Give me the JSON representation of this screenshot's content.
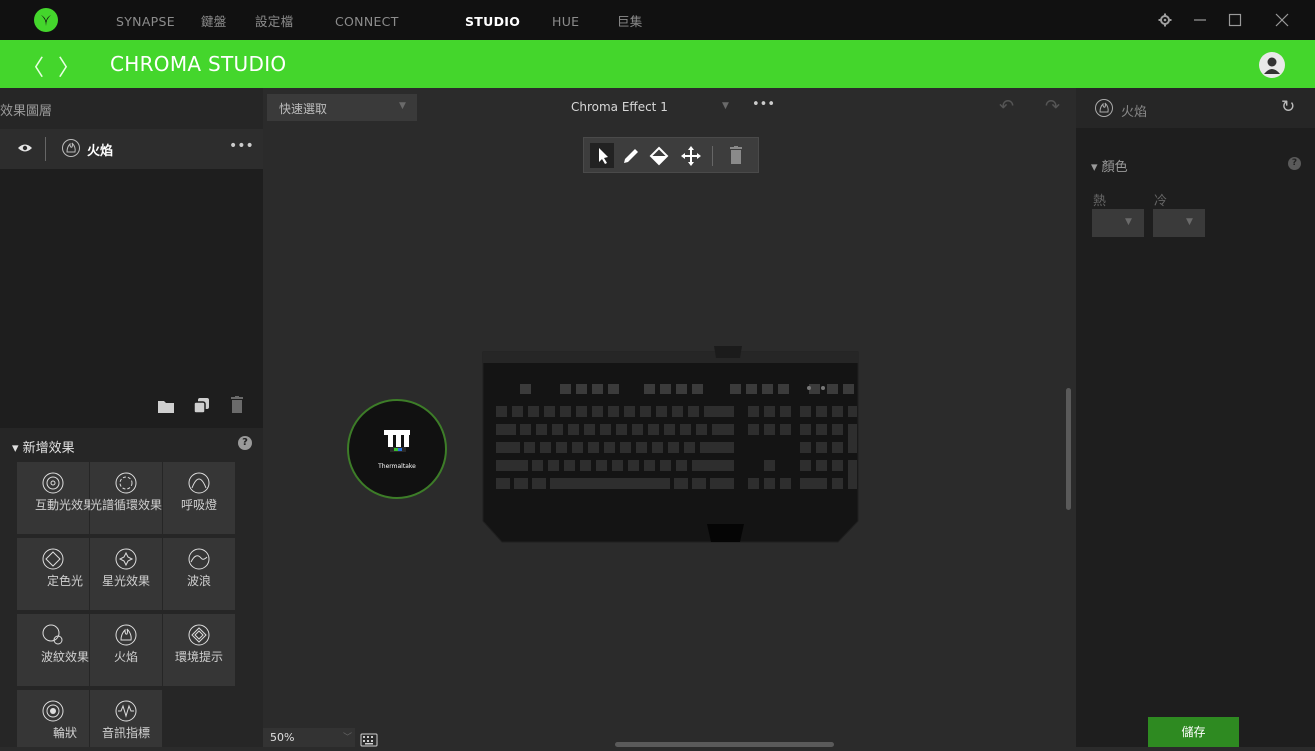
{
  "topnav": {
    "tabs": [
      {
        "label": "SYNAPSE",
        "active": false
      },
      {
        "label": "鍵盤",
        "active": false
      },
      {
        "label": "設定檔",
        "active": false
      },
      {
        "label": "CONNECT",
        "active": false
      },
      {
        "label": "STUDIO",
        "active": true
      },
      {
        "label": "HUE",
        "active": false
      },
      {
        "label": "巨集",
        "active": false
      }
    ],
    "window_controls": [
      "gear-icon",
      "minimize-icon",
      "maximize-icon",
      "close-icon"
    ]
  },
  "header": {
    "title": "CHROMA STUDIO",
    "back_icon": "chevron-left-icon",
    "forward_icon": "chevron-right-icon",
    "accent": "#44d62c"
  },
  "layers": {
    "title": "效果圖層",
    "items": [
      {
        "label": "火焰",
        "visible": true
      }
    ],
    "more_label": "•••"
  },
  "add_effect": {
    "title": "新增效果",
    "items": [
      {
        "label": "互動光效果",
        "icon": "ripple-icon"
      },
      {
        "label": "光譜循環效果",
        "icon": "spectrum-icon"
      },
      {
        "label": "呼吸燈",
        "icon": "breathing-icon"
      },
      {
        "label": "定色光",
        "icon": "static-icon"
      },
      {
        "label": "星光效果",
        "icon": "starlight-icon"
      },
      {
        "label": "波浪",
        "icon": "wave-icon"
      },
      {
        "label": "波紋效果",
        "icon": "reactive-icon"
      },
      {
        "label": "火焰",
        "icon": "fire-icon"
      },
      {
        "label": "環境提示",
        "icon": "ambient-icon"
      },
      {
        "label": "輪狀",
        "icon": "wheel-icon"
      },
      {
        "label": "音訊指標",
        "icon": "audio-icon"
      }
    ]
  },
  "canvas": {
    "quick_select_label": "快速選取",
    "effect_name": "Chroma Effect 1",
    "more_label": "•••",
    "zoom": "50%",
    "device_label": "Thermaltake"
  },
  "properties": {
    "title": "火焰",
    "color_section": "顏色",
    "hot_label": "熱",
    "cold_label": "冷",
    "save_label": "儲存"
  }
}
